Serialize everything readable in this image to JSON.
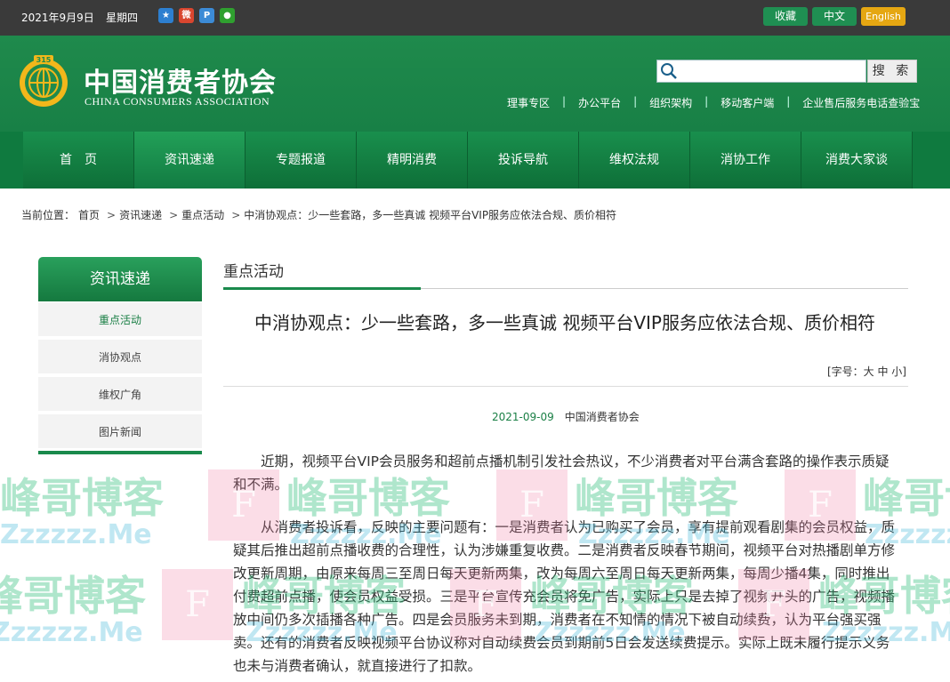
{
  "topbar": {
    "date": "2021年9月9日",
    "weekday": "星期四",
    "share_icons": [
      "qzone-icon",
      "weibo-icon",
      "tencent-weibo-icon",
      "wechat-icon"
    ],
    "favorite": "收藏",
    "chinese": "中文",
    "english": "English"
  },
  "header": {
    "logo_cn": "中国消费者协会",
    "logo_en": "CHINA CONSUMERS ASSOCIATION",
    "search_placeholder": "",
    "search_button": "搜 索",
    "links": [
      "理事专区",
      "办公平台",
      "组织架构",
      "移动客户端",
      "企业售后服务电话查验宝"
    ]
  },
  "nav": {
    "items": [
      "首　页",
      "资讯速递",
      "专题报道",
      "精明消费",
      "投诉导航",
      "维权法规",
      "消协工作",
      "消费大家谈"
    ],
    "active_index": 1
  },
  "breadcrumb": {
    "prefix": "当前位置：",
    "items": [
      "首页",
      "资讯速递",
      "重点活动",
      "中消协观点：少一些套路，多一些真诚 视频平台VIP服务应依法合规、质价相符"
    ]
  },
  "sidebar": {
    "title": "资讯速递",
    "items": [
      "重点活动",
      "消协观点",
      "维权广角",
      "图片新闻"
    ],
    "active_index": 0
  },
  "main": {
    "section_title": "重点活动",
    "article_title": "中消协观点：少一些套路，多一些真诚 视频平台VIP服务应依法合规、质价相符",
    "font_size_control": "[字号：大 中 小]",
    "date": "2021-09-09",
    "source": "中国消费者协会",
    "paragraphs": [
      "近期，视频平台VIP会员服务和超前点播机制引发社会热议，不少消费者对平台满含套路的操作表示质疑和不满。",
      "从消费者投诉看，反映的主要问题有：一是消费者认为已购买了会员，享有提前观看剧集的会员权益，质疑其后推出超前点播收费的合理性，认为涉嫌重复收费。二是消费者反映春节期间，视频平台对热播剧单方修改更新周期，由原来每周三至周日每天更新两集，改为每周六至周日每天更新两集，每周少播4集，同时推出付费超前点播，使会员权益受损。三是平台宣传充会员将免广告，实际上只是去掉了视频开头的广告，视频播放中间仍多次插播各种广告。四是会员服务未到期，消费者在不知情的情况下被自动续费，认为平台强买强卖。还有的消费者反映视频平台协议称对自动续费会员到期前5日会发送续费提示。实际上既未履行提示义务也未与消费者确认，就直接进行了扣款。"
    ]
  },
  "watermark": {
    "text_cn": "峰哥博客",
    "text_en": "Zzzzzz.Me",
    "box_letter": "F"
  },
  "colors": {
    "primary_green": "#1a8a4c",
    "topbar": "#3a3a3a",
    "english_btn": "#e5a712"
  }
}
